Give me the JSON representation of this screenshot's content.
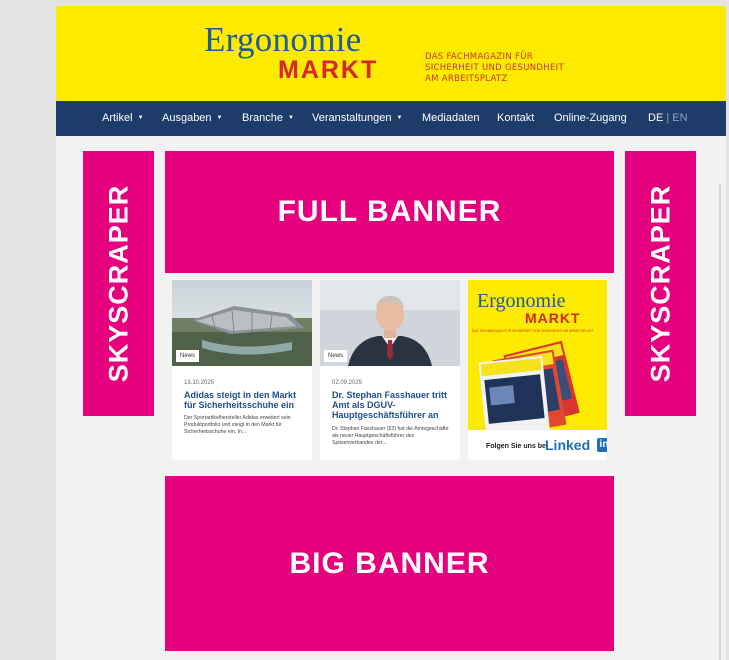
{
  "header": {
    "logo_line1": "Ergonomie",
    "logo_line2": "MARKT",
    "tagline_1": "DAS FACHMAGAZIN FÜR",
    "tagline_2": "SICHERHEIT UND GESUNDHEIT",
    "tagline_3": "AM ARBEITSPLATZ"
  },
  "nav": {
    "items": [
      {
        "label": "Artikel"
      },
      {
        "label": "Ausgaben"
      },
      {
        "label": "Branche"
      },
      {
        "label": "Veranstaltungen"
      },
      {
        "label": "Mediadaten"
      },
      {
        "label": "Kontakt"
      },
      {
        "label": "Online-Zugang"
      }
    ],
    "lang_de": "DE",
    "lang_sep": "|",
    "lang_en": "EN"
  },
  "ads": {
    "full_banner": "FULL BANNER",
    "big_banner": "BIG BANNER",
    "skyscraper": "SKYSCRAPER"
  },
  "cards": [
    {
      "badge": "News",
      "date": "13.10.2025",
      "title": "Adidas steigt in den Markt für Sicherheitsschuhe ein",
      "excerpt": "Der Sportartikelhersteller Adidas erweitert sein Produktportfolio und steigt in den Markt für Sicherheitsschuhe ein. In..."
    },
    {
      "badge": "News",
      "date": "02.09.2025",
      "title": "Dr. Stephan Fasshauer tritt Amt als DGUV-Hauptgeschäftsführer an",
      "excerpt": "Dr. Stephan Fasshauer (52) hat die Amtsgeschäfte als neuer Hauptgeschäftsführer des Spitzenverbandes der..."
    }
  ],
  "promo": {
    "logo_line1": "Ergonomie",
    "logo_line2": "MARKT",
    "tagline": "DAS FACHMAGAZIN FÜR SICHERHEIT UND GESUNDHEIT AM ARBEITSPLATZ",
    "follow_text": "Folgen Sie uns bei",
    "linked_text": "Linked",
    "in_text": "in"
  },
  "colors": {
    "brand_yellow": "#fcea00",
    "brand_blue": "#1f5c99",
    "brand_red": "#d6272e",
    "nav_bg": "#1d3c6a",
    "ad_magenta": "#e5007e",
    "linkedin_blue": "#1e6fb6"
  }
}
